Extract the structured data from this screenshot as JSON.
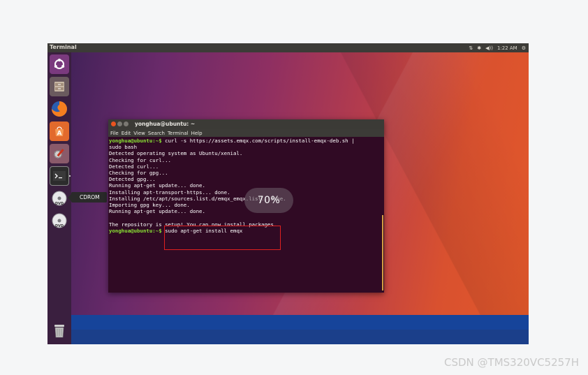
{
  "top_panel": {
    "app_title": "Terminal",
    "indicators": [
      "keyboard-icon",
      "bluetooth-icon",
      "volume-icon"
    ],
    "clock": "1:22 AM",
    "settings_icon": "gear-icon"
  },
  "launcher": {
    "items": [
      {
        "name": "ubuntu-dash",
        "icon": "ubuntu-logo-icon"
      },
      {
        "name": "files",
        "icon": "file-cabinet-icon"
      },
      {
        "name": "firefox",
        "icon": "firefox-icon"
      },
      {
        "name": "software-center",
        "icon": "shopping-bag-icon"
      },
      {
        "name": "system-settings",
        "icon": "wrench-gear-icon"
      },
      {
        "name": "terminal",
        "icon": "terminal-icon"
      },
      {
        "name": "cdrom-1",
        "icon": "dvd-icon"
      },
      {
        "name": "cdrom-2",
        "icon": "dvd-icon"
      },
      {
        "name": "trash",
        "icon": "trash-icon"
      }
    ],
    "tooltip": "CDROM"
  },
  "terminal": {
    "title": "yonghua@ubuntu: ~",
    "menu": [
      "File",
      "Edit",
      "View",
      "Search",
      "Terminal",
      "Help"
    ],
    "lines": [
      {
        "prompt": "yonghua@ubuntu:~$",
        "text": " curl -s https://assets.emqx.com/scripts/install-emqx-deb.sh |"
      },
      {
        "prompt": "",
        "text": "sudo bash"
      },
      {
        "prompt": "",
        "text": "Detected operating system as Ubuntu/xenial."
      },
      {
        "prompt": "",
        "text": "Checking for curl..."
      },
      {
        "prompt": "",
        "text": "Detected curl..."
      },
      {
        "prompt": "",
        "text": "Checking for gpg..."
      },
      {
        "prompt": "",
        "text": "Detected gpg..."
      },
      {
        "prompt": "",
        "text": "Running apt-get update... done."
      },
      {
        "prompt": "",
        "text": "Installing apt-transport-https... done."
      },
      {
        "prompt": "",
        "text": "Installing /etc/apt/sources.list.d/emqx_emqx.list...done."
      },
      {
        "prompt": "",
        "text": "Importing gpg key... done."
      },
      {
        "prompt": "",
        "text": "Running apt-get update... done."
      },
      {
        "prompt": "",
        "text": ""
      },
      {
        "prompt": "",
        "text": "The repository is setup! You can now install packages."
      },
      {
        "prompt": "yonghua@ubuntu:~$",
        "text": " sudo apt-get install emqx"
      }
    ]
  },
  "progress_overlay": "70%",
  "watermark": "CSDN @TMS320VC5257H"
}
